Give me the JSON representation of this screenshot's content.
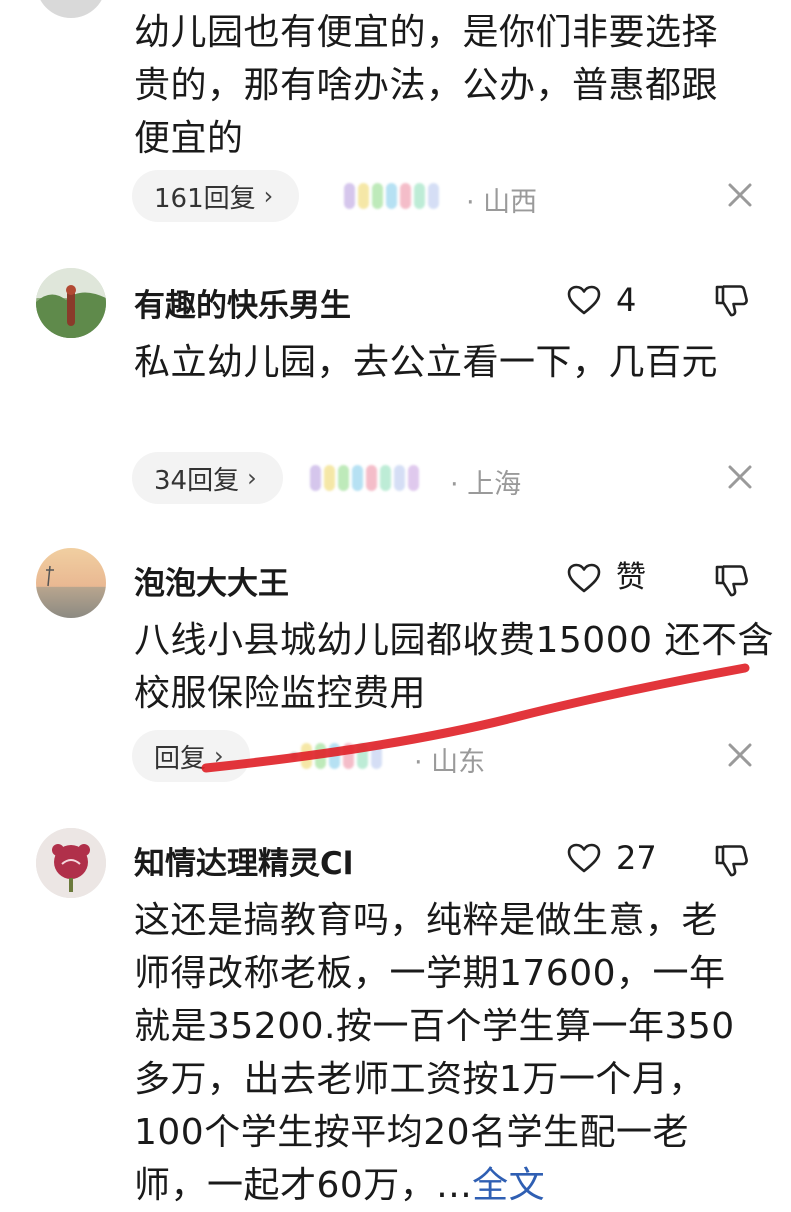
{
  "comments": [
    {
      "text": "幼儿园也有便宜的，是你们非要选择贵的，那有啥办法，公办，普惠都跟便宜的",
      "reply_label": "161回复",
      "location": "· 山西"
    },
    {
      "username": "有趣的快乐男生",
      "like_count": "4",
      "text": "私立幼儿园，去公立看一下，几百元",
      "reply_label": "34回复",
      "location": "· 上海"
    },
    {
      "username": "泡泡大大王",
      "like_count": "赞",
      "text": "八线小县城幼儿园都收费15000 还不含校服保险监控费用",
      "reply_label": "回复",
      "location": "· 山东"
    },
    {
      "username": "知情达理精灵Cl",
      "like_count": "27",
      "text": "这还是搞教育吗，纯粹是做生意，老师得改称老板，一学期17600，一年就是35200.按一百个学生算一年350多万，出去老师工资按1万一个月，100个学生按平均20名学生配一老师，一起才60万，...",
      "read_more": "全文"
    }
  ],
  "icons": {
    "like": "heart-outline-icon",
    "dislike": "thumbs-down-icon",
    "close": "close-icon",
    "chevron": "chevron-right-icon"
  },
  "colors": {
    "read_more": "#2f5fb3",
    "annotation_stroke": "#e0242a",
    "meta_gray": "#9a9a9a",
    "pill_bg": "#f3f3f3"
  }
}
